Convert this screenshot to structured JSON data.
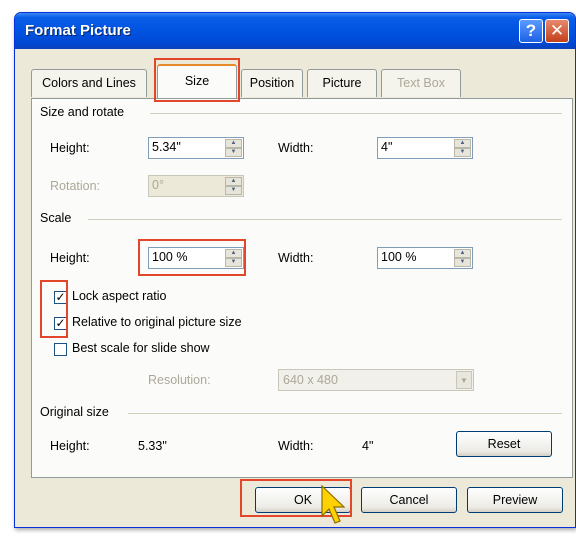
{
  "window": {
    "title": "Format Picture",
    "help_label": "?",
    "close_label": "✕"
  },
  "tabs": [
    {
      "label": "Colors and Lines",
      "state": "normal"
    },
    {
      "label": "Size",
      "state": "active"
    },
    {
      "label": "Position",
      "state": "normal"
    },
    {
      "label": "Picture",
      "state": "normal"
    },
    {
      "label": "Text Box",
      "state": "disabled"
    }
  ],
  "size_rotate": {
    "group_label": "Size and rotate",
    "height_label": "Height:",
    "height_value": "5.34\"",
    "width_label": "Width:",
    "width_value": "4\"",
    "rotation_label": "Rotation:",
    "rotation_value": "0°"
  },
  "scale": {
    "group_label": "Scale",
    "height_label": "Height:",
    "height_value": "100 %",
    "width_label": "Width:",
    "width_value": "100 %",
    "lock_aspect": {
      "label": "Lock aspect ratio",
      "checked": true
    },
    "relative_original": {
      "label": "Relative to original picture size",
      "checked": true
    },
    "best_scale": {
      "label": "Best scale for slide show",
      "checked": false
    },
    "resolution_label": "Resolution:",
    "resolution_value": "640 x 480"
  },
  "original_size": {
    "group_label": "Original size",
    "height_label": "Height:",
    "height_value": "5.33\"",
    "width_label": "Width:",
    "width_value": "4\"",
    "reset_label": "Reset"
  },
  "footer": {
    "ok_label": "OK",
    "cancel_label": "Cancel",
    "preview_label": "Preview"
  },
  "colors": {
    "title_bar": "#0053e0",
    "dialog_bg": "#ece9d8",
    "highlight_box": "#e2462b",
    "cursor": "#ffd100"
  }
}
